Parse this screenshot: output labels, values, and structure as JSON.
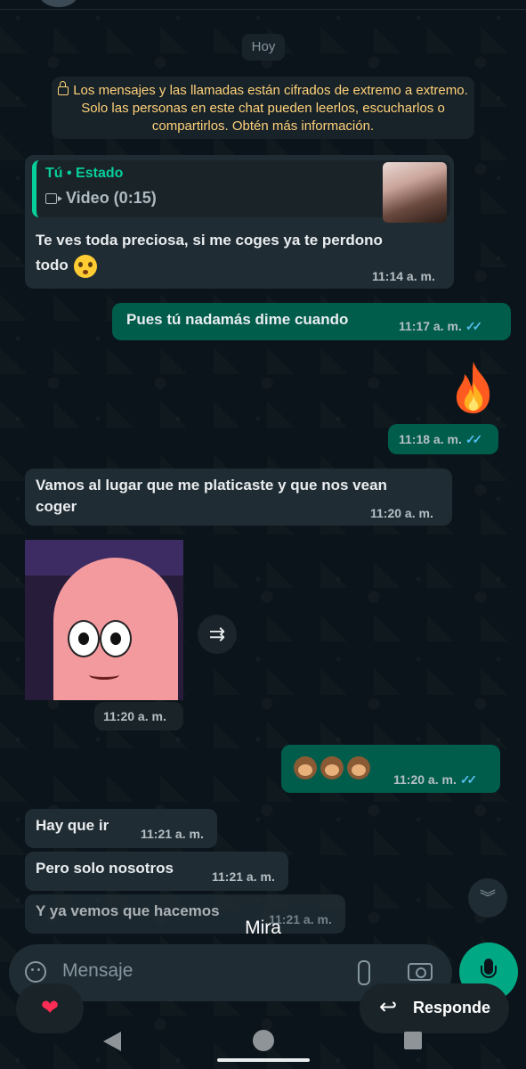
{
  "chat": {
    "date_label": "Hoy",
    "encryption_notice": "Los mensajes y las llamadas están cifrados de extremo a extremo. Solo las personas en este chat pueden leerlos, escucharlos o compartirlos. Obtén más información.",
    "messages": [
      {
        "direction": "in",
        "quote_title": "Tú • Estado",
        "quote_sub": "Video (0:15)",
        "text": "Te ves toda preciosa, si me coges ya te perdono todo",
        "emoji": "flushed-face",
        "time": "11:14 a. m."
      },
      {
        "direction": "out",
        "text": "Pues tú nadamás dime cuando",
        "time": "11:17 a. m.",
        "status": "read"
      },
      {
        "direction": "out",
        "text": "",
        "emoji": "fire",
        "time": "11:18 a. m.",
        "status": "read"
      },
      {
        "direction": "in",
        "text": "Vamos al lugar que me platicaste y que nos vean coger",
        "time": "11:20 a. m."
      },
      {
        "direction": "in",
        "text": "",
        "media": "patrick-sticker-image",
        "time": "11:20 a. m."
      },
      {
        "direction": "out",
        "text": "",
        "emoji": "see-no-evil-monkey x3",
        "time": "11:20 a. m.",
        "status": "read"
      },
      {
        "direction": "in",
        "text": "Hay que ir",
        "time": "11:21 a. m."
      },
      {
        "direction": "in",
        "text": "Pero solo nosotros",
        "time": "11:21 a. m."
      },
      {
        "direction": "in",
        "text": "Y ya vemos que hacemos",
        "time": "11:21 a. m."
      }
    ]
  },
  "overlay_caption": "Mira",
  "composer": {
    "placeholder": "Mensaje"
  },
  "story_reply": {
    "reply_label": "Responde"
  },
  "colors": {
    "accent": "#00a884",
    "outgoing_bubble": "#005c4b",
    "incoming_bubble": "#202c33",
    "read_ticks": "#53bdeb"
  }
}
